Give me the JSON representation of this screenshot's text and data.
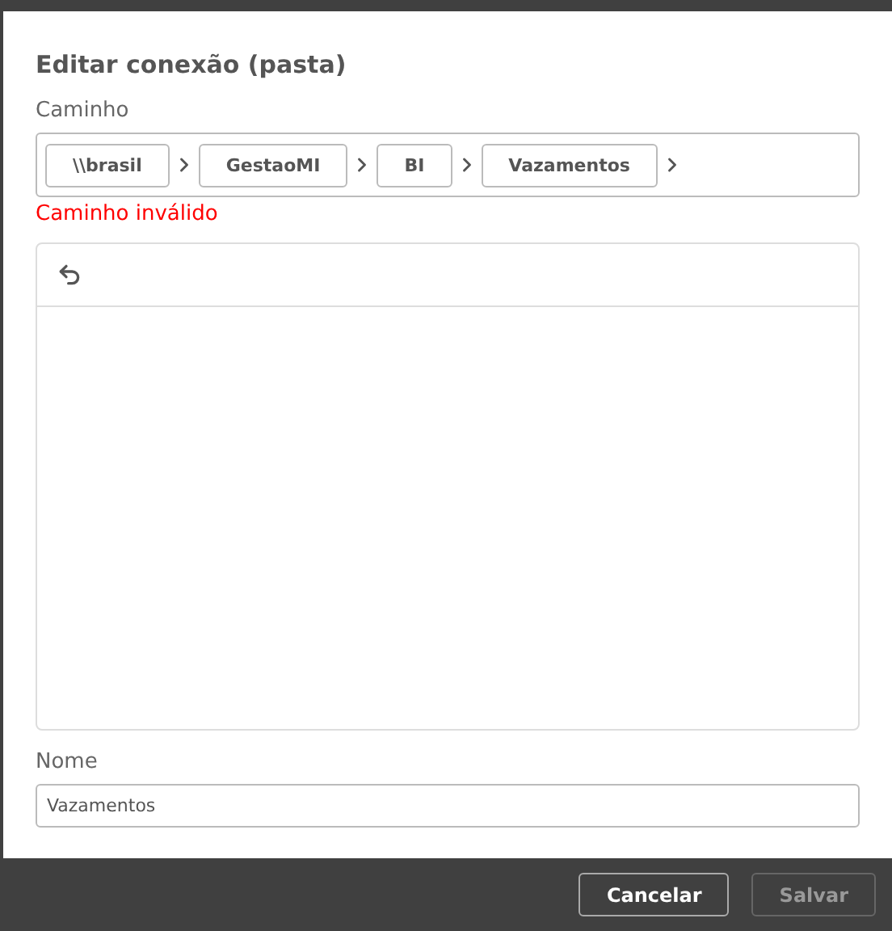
{
  "dialog": {
    "title": "Editar conexão (pasta)"
  },
  "path": {
    "label": "Caminho",
    "segments": [
      "\\\\brasil",
      "GestaoMI",
      "BI",
      "Vazamentos"
    ],
    "error": "Caminho inválido"
  },
  "name": {
    "label": "Nome",
    "value": "Vazamentos"
  },
  "buttons": [
    {
      "label": "Cancelar",
      "disabled": false
    },
    {
      "label": "Salvar",
      "disabled": true
    }
  ]
}
